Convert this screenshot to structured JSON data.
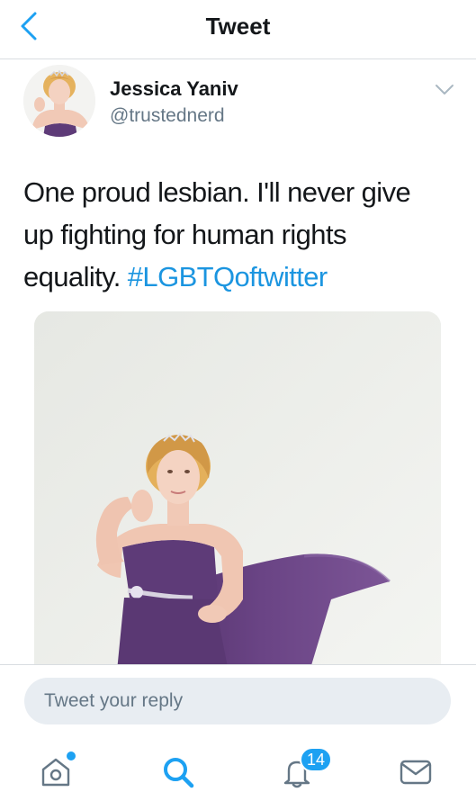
{
  "header": {
    "title": "Tweet",
    "back_icon": "chevron-left-icon"
  },
  "tweet": {
    "author_name": "Jessica Yaniv",
    "author_handle": "@trustednerd",
    "text_part1": "One proud lesbian. I'll never give up fighting for human rights equality. ",
    "hashtag": "#LGBTQoftwitter",
    "menu_icon": "chevron-down-icon",
    "photo_icon": "tweet-photo"
  },
  "reply": {
    "placeholder": "Tweet your reply"
  },
  "tabbar": {
    "home_icon": "home-icon",
    "search_icon": "search-icon",
    "notifications_icon": "bell-icon",
    "notifications_count": "14",
    "messages_icon": "envelope-icon"
  },
  "colors": {
    "accent": "#1da1f2",
    "hashtag": "#1b95e0",
    "secondary_text": "#657786",
    "divider": "#d9dde1",
    "dress": "#5e3b78"
  }
}
